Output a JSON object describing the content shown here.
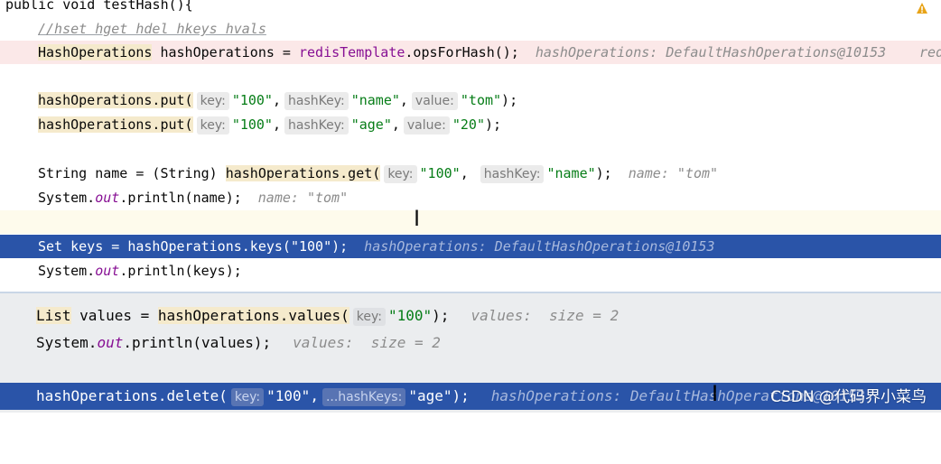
{
  "editor": {
    "method_decl": "public void testHash(){",
    "comment": "//hset hget hdel hkeys hvals",
    "line_ops": {
      "type": "HashOperations",
      "rest_prefix": " hashOperations = ",
      "field": "redisTemplate",
      "rest_suffix": ".opsForHash();",
      "inlay": "hashOperations: DefaultHashOperations@10153",
      "cut_off": "red"
    },
    "put1": {
      "call": "hashOperations.put(",
      "hint_key": "key:",
      "key": "\"100\"",
      "hint_hash": "hashKey:",
      "hash": "\"name\"",
      "hint_value": "value:",
      "value": "\"tom\"",
      "end": ");"
    },
    "put2": {
      "call": "hashOperations.put(",
      "hint_key": "key:",
      "key": "\"100\"",
      "hint_hash": "hashKey:",
      "hash": "\"age\"",
      "hint_value": "value:",
      "value": "\"20\"",
      "end": ");"
    },
    "get_line": {
      "prefix": "String name = (String) ",
      "call": "hashOperations.get(",
      "hint_key": "key:",
      "key": "\"100\"",
      "hint_hash": "hashKey:",
      "hash": "\"name\"",
      "end": ");",
      "inlay": "name: \"tom\""
    },
    "print_name": {
      "prefix": "System.",
      "out": "out",
      "suffix": ".println(name);",
      "inlay": "name: \"tom\""
    },
    "keys_line": {
      "code": "Set keys = hashOperations.keys(\"100\");",
      "inlay": "hashOperations: DefaultHashOperations@10153"
    },
    "print_keys": {
      "prefix": "System.",
      "out": "out",
      "suffix": ".println(keys);"
    },
    "values_line": {
      "type": "List",
      "mid": " values = ",
      "call": "hashOperations.values(",
      "hint_key": "key:",
      "key": "\"100\"",
      "end": ");",
      "inlay": "values:  size = 2"
    },
    "print_values": {
      "prefix": "System.",
      "out": "out",
      "suffix": ".println(values);",
      "inlay": "values:  size = 2"
    },
    "delete_line": {
      "call": "hashOperations.delete(",
      "hint_key": "key:",
      "key": "\"100\"",
      "hint_hash": "...hashKeys:",
      "hash": "\"age\"",
      "end": ");",
      "inlay": "hashOperations: DefaultHashOperations@10153"
    }
  },
  "watermark": "CSDN @代码界小菜鸟",
  "colors": {
    "selection": "#2a54a8",
    "error_line": "#fbe8e8",
    "highlight": "#f5eacc"
  }
}
